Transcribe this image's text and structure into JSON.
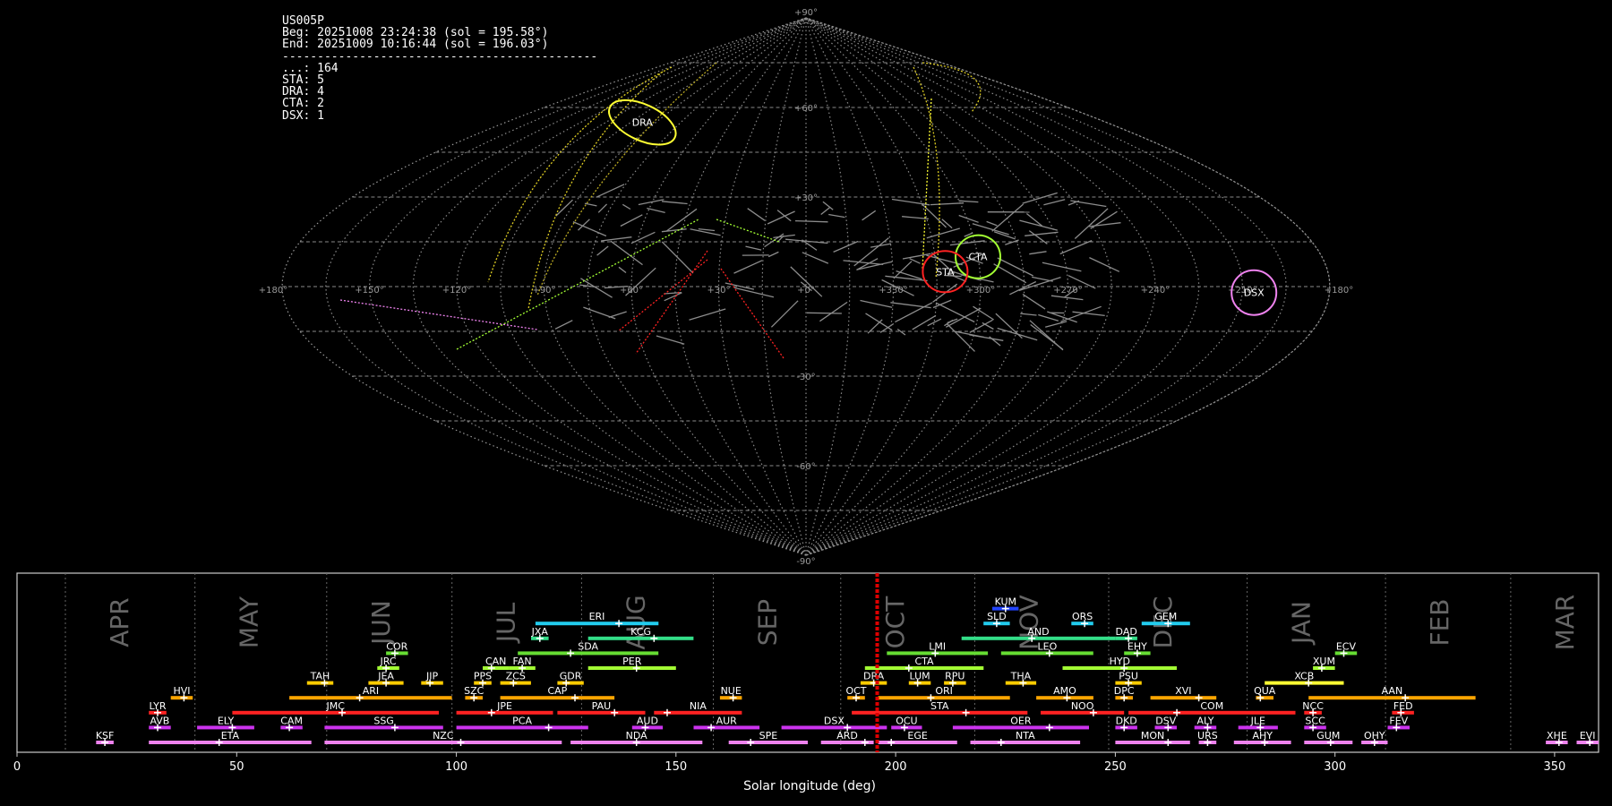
{
  "info": {
    "station": "US005P",
    "begin": "Beg: 20251008 23:24:38 (sol = 195.58°)",
    "end": "End: 20251009 10:16:44 (sol = 196.03°)",
    "separator": "---------------------------------------------",
    "counts": [
      {
        "label": "...",
        "value": 164
      },
      {
        "label": "STA",
        "value": 5
      },
      {
        "label": "DRA",
        "value": 4
      },
      {
        "label": "CTA",
        "value": 2
      },
      {
        "label": "DSX",
        "value": 1
      }
    ]
  },
  "chart_data": [
    {
      "type": "scatter",
      "projection": "sinusoidal",
      "x_ticks": [
        "+180°",
        "+150°",
        "+120°",
        "+90°",
        "+60°",
        "+30°",
        "+0°",
        "+330°",
        "+300°",
        "+270°",
        "+240°",
        "+210°",
        "+180°"
      ],
      "y_ticks": [
        "+90°",
        "+60°",
        "+30°",
        "-30°",
        "-60°",
        "-90°"
      ],
      "grid": true,
      "radiants": [
        {
          "name": "DRA",
          "ra": 262,
          "dec": 55,
          "color": "#ffff33"
        },
        {
          "name": "CTA",
          "ra": 60,
          "dec": 10,
          "color": "#a3ff33"
        },
        {
          "name": "STA",
          "ra": 48,
          "dec": 5,
          "color": "#ff2222"
        },
        {
          "name": "DSX",
          "ra": 154,
          "dec": -2,
          "color": "#ee82ee"
        }
      ]
    },
    {
      "type": "bar",
      "orientation": "horizontal",
      "xlabel": "Solar longitude (deg)",
      "xlim": [
        0,
        360
      ],
      "x_ticks": [
        0,
        50,
        100,
        150,
        200,
        250,
        300,
        350
      ],
      "current_sol": 195.8,
      "months": [
        {
          "name": "APR",
          "start": 11
        },
        {
          "name": "MAY",
          "start": 40.5
        },
        {
          "name": "JUN",
          "start": 70.5
        },
        {
          "name": "JUL",
          "start": 99
        },
        {
          "name": "AUG",
          "start": 128.5
        },
        {
          "name": "SEP",
          "start": 158.5
        },
        {
          "name": "OCT",
          "start": 187.5
        },
        {
          "name": "NOV",
          "start": 218
        },
        {
          "name": "DEC",
          "start": 248.5
        },
        {
          "name": "JAN",
          "start": 280
        },
        {
          "name": "FEB",
          "start": 311.5
        },
        {
          "name": "MAR",
          "start": 340
        }
      ],
      "showers": [
        {
          "code": "KSF",
          "start": 18,
          "end": 22,
          "peak": 20,
          "row": 0,
          "color": "#ee82ee"
        },
        {
          "code": "ETA",
          "start": 30,
          "end": 67,
          "peak": 46,
          "row": 0,
          "color": "#ee82ee"
        },
        {
          "code": "NZC",
          "start": 70,
          "end": 124,
          "peak": 101,
          "row": 0,
          "color": "#ee82ee"
        },
        {
          "code": "NDA",
          "start": 126,
          "end": 156,
          "peak": 141,
          "row": 0,
          "color": "#ee82ee"
        },
        {
          "code": "SPE",
          "start": 162,
          "end": 180,
          "peak": 167,
          "row": 0,
          "color": "#ee82ee"
        },
        {
          "code": "ARD",
          "start": 183,
          "end": 195,
          "peak": 193,
          "row": 0,
          "color": "#ee82ee"
        },
        {
          "code": "EGE",
          "start": 196,
          "end": 214,
          "peak": 199,
          "row": 0,
          "color": "#ee82ee"
        },
        {
          "code": "NTA",
          "start": 217,
          "end": 242,
          "peak": 224,
          "row": 0,
          "color": "#ee82ee"
        },
        {
          "code": "MON",
          "start": 250,
          "end": 267,
          "peak": 262,
          "row": 0,
          "color": "#ee82ee"
        },
        {
          "code": "URS",
          "start": 269,
          "end": 273,
          "peak": 271,
          "row": 0,
          "color": "#ee82ee"
        },
        {
          "code": "AHY",
          "start": 277,
          "end": 290,
          "peak": 284,
          "row": 0,
          "color": "#ee82ee"
        },
        {
          "code": "GUM",
          "start": 293,
          "end": 304,
          "peak": 299,
          "row": 0,
          "color": "#ee82ee"
        },
        {
          "code": "OHY",
          "start": 306,
          "end": 312,
          "peak": 309,
          "row": 0,
          "color": "#ee82ee"
        },
        {
          "code": "XHE",
          "start": 348,
          "end": 353,
          "peak": 351,
          "row": 0,
          "color": "#ee82ee"
        },
        {
          "code": "EVI",
          "start": 355,
          "end": 360,
          "peak": 358,
          "row": 0,
          "color": "#ee82ee"
        },
        {
          "code": "AVB",
          "start": 30,
          "end": 35,
          "peak": 32,
          "row": 1,
          "color": "#cc33ee"
        },
        {
          "code": "ELY",
          "start": 41,
          "end": 54,
          "peak": 49,
          "row": 1,
          "color": "#cc33ee"
        },
        {
          "code": "CAM",
          "start": 60,
          "end": 65,
          "peak": 62,
          "row": 1,
          "color": "#cc33ee"
        },
        {
          "code": "SSG",
          "start": 70,
          "end": 97,
          "peak": 86,
          "row": 1,
          "color": "#cc33ee"
        },
        {
          "code": "PCA",
          "start": 100,
          "end": 130,
          "peak": 121,
          "row": 1,
          "color": "#cc33ee"
        },
        {
          "code": "AUD",
          "start": 140,
          "end": 147,
          "peak": 143,
          "row": 1,
          "color": "#cc33ee"
        },
        {
          "code": "AUR",
          "start": 154,
          "end": 169,
          "peak": 158,
          "row": 1,
          "color": "#cc33ee"
        },
        {
          "code": "DSX",
          "start": 174,
          "end": 198,
          "peak": 189,
          "row": 1,
          "color": "#cc33ee"
        },
        {
          "code": "OCU",
          "start": 199,
          "end": 206,
          "peak": 202,
          "row": 1,
          "color": "#cc33ee"
        },
        {
          "code": "OER",
          "start": 213,
          "end": 244,
          "peak": 235,
          "row": 1,
          "color": "#cc33ee"
        },
        {
          "code": "DKD",
          "start": 250,
          "end": 255,
          "peak": 252,
          "row": 1,
          "color": "#cc33ee"
        },
        {
          "code": "DSV",
          "start": 259,
          "end": 264,
          "peak": 262,
          "row": 1,
          "color": "#cc33ee"
        },
        {
          "code": "ALY",
          "start": 268,
          "end": 273,
          "peak": 271,
          "row": 1,
          "color": "#cc33ee"
        },
        {
          "code": "JLE",
          "start": 278,
          "end": 287,
          "peak": 283,
          "row": 1,
          "color": "#cc33ee"
        },
        {
          "code": "SCC",
          "start": 293,
          "end": 298,
          "peak": 295,
          "row": 1,
          "color": "#cc33ee"
        },
        {
          "code": "FEV",
          "start": 312,
          "end": 317,
          "peak": 314,
          "row": 1,
          "color": "#cc33ee"
        },
        {
          "code": "LYR",
          "start": 30,
          "end": 34,
          "peak": 32,
          "row": 2,
          "color": "#ff2222"
        },
        {
          "code": "JMC",
          "start": 49,
          "end": 96,
          "peak": 74,
          "row": 2,
          "color": "#ff2222"
        },
        {
          "code": "JPE",
          "start": 100,
          "end": 122,
          "peak": 108,
          "row": 2,
          "color": "#ff2222"
        },
        {
          "code": "PAU",
          "start": 123,
          "end": 143,
          "peak": 136,
          "row": 2,
          "color": "#ff2222"
        },
        {
          "code": "NIA",
          "start": 145,
          "end": 165,
          "peak": 148,
          "row": 2,
          "color": "#ff2222"
        },
        {
          "code": "STA",
          "start": 190,
          "end": 230,
          "peak": 216,
          "row": 2,
          "color": "#ff2222"
        },
        {
          "code": "NOO",
          "start": 233,
          "end": 252,
          "peak": 245,
          "row": 2,
          "color": "#ff2222"
        },
        {
          "code": "COM",
          "start": 253,
          "end": 291,
          "peak": 264,
          "row": 2,
          "color": "#ff2222"
        },
        {
          "code": "NCC",
          "start": 293,
          "end": 297,
          "peak": 295,
          "row": 2,
          "color": "#ff2222"
        },
        {
          "code": "FED",
          "start": 313,
          "end": 318,
          "peak": 315,
          "row": 2,
          "color": "#ff2222"
        },
        {
          "code": "HVI",
          "start": 35,
          "end": 40,
          "peak": 38,
          "row": 3,
          "color": "#ffa500"
        },
        {
          "code": "ARI",
          "start": 62,
          "end": 99,
          "peak": 78,
          "row": 3,
          "color": "#ffa500"
        },
        {
          "code": "SZC",
          "start": 102,
          "end": 106,
          "peak": 104,
          "row": 3,
          "color": "#ffa500"
        },
        {
          "code": "CAP",
          "start": 110,
          "end": 136,
          "peak": 127,
          "row": 3,
          "color": "#ffa500"
        },
        {
          "code": "NUE",
          "start": 160,
          "end": 165,
          "peak": 163,
          "row": 3,
          "color": "#ffa500"
        },
        {
          "code": "OCT",
          "start": 189,
          "end": 193,
          "peak": 191,
          "row": 3,
          "color": "#ffa500"
        },
        {
          "code": "ORI",
          "start": 196,
          "end": 226,
          "peak": 208,
          "row": 3,
          "color": "#ffa500"
        },
        {
          "code": "AMO",
          "start": 232,
          "end": 245,
          "peak": 239,
          "row": 3,
          "color": "#ffa500"
        },
        {
          "code": "DPC",
          "start": 250,
          "end": 254,
          "peak": 252,
          "row": 3,
          "color": "#ffa500"
        },
        {
          "code": "XVI",
          "start": 258,
          "end": 273,
          "peak": 269,
          "row": 3,
          "color": "#ffa500"
        },
        {
          "code": "QUA",
          "start": 282,
          "end": 286,
          "peak": 283,
          "row": 3,
          "color": "#ffa500"
        },
        {
          "code": "AAN",
          "start": 294,
          "end": 332,
          "peak": 316,
          "row": 3,
          "color": "#ffa500"
        },
        {
          "code": "TAH",
          "start": 66,
          "end": 72,
          "peak": 70,
          "row": 4,
          "color": "#ffcc00"
        },
        {
          "code": "JEA",
          "start": 80,
          "end": 88,
          "peak": 84,
          "row": 4,
          "color": "#ffcc00"
        },
        {
          "code": "JIP",
          "start": 92,
          "end": 97,
          "peak": 94,
          "row": 4,
          "color": "#ffcc00"
        },
        {
          "code": "PPS",
          "start": 104,
          "end": 108,
          "peak": 106,
          "row": 4,
          "color": "#ffcc00"
        },
        {
          "code": "ZCS",
          "start": 110,
          "end": 117,
          "peak": 113,
          "row": 4,
          "color": "#ffcc00"
        },
        {
          "code": "GDR",
          "start": 123,
          "end": 129,
          "peak": 125,
          "row": 4,
          "color": "#ffcc00"
        },
        {
          "code": "DRA",
          "start": 192,
          "end": 198,
          "peak": 195,
          "row": 4,
          "color": "#ffcc00"
        },
        {
          "code": "LUM",
          "start": 203,
          "end": 208,
          "peak": 205,
          "row": 4,
          "color": "#ffcc00"
        },
        {
          "code": "RPU",
          "start": 211,
          "end": 216,
          "peak": 213,
          "row": 4,
          "color": "#ffcc00"
        },
        {
          "code": "THA",
          "start": 225,
          "end": 232,
          "peak": 229,
          "row": 4,
          "color": "#ffcc00"
        },
        {
          "code": "PSU",
          "start": 250,
          "end": 256,
          "peak": 253,
          "row": 4,
          "color": "#ffcc00"
        },
        {
          "code": "XCB",
          "start": 284,
          "end": 302,
          "peak": 294,
          "row": 4,
          "color": "#ffff33"
        },
        {
          "code": "JRC",
          "start": 82,
          "end": 87,
          "peak": 84,
          "row": 5,
          "color": "#a3ff33"
        },
        {
          "code": "CAN",
          "start": 106,
          "end": 112,
          "peak": 108,
          "row": 5,
          "color": "#a3ff33"
        },
        {
          "code": "FAN",
          "start": 112,
          "end": 118,
          "peak": 115,
          "row": 5,
          "color": "#a3ff33"
        },
        {
          "code": "PER",
          "start": 130,
          "end": 150,
          "peak": 141,
          "row": 5,
          "color": "#a3ff33"
        },
        {
          "code": "CTA",
          "start": 193,
          "end": 220,
          "peak": 203,
          "row": 5,
          "color": "#a3ff33"
        },
        {
          "code": "HYD",
          "start": 238,
          "end": 264,
          "peak": 252,
          "row": 5,
          "color": "#a3ff33"
        },
        {
          "code": "XUM",
          "start": 295,
          "end": 300,
          "peak": 297,
          "row": 5,
          "color": "#a3ff33"
        },
        {
          "code": "COR",
          "start": 84,
          "end": 89,
          "peak": 86,
          "row": 6,
          "color": "#66dd33"
        },
        {
          "code": "SDA",
          "start": 114,
          "end": 146,
          "peak": 126,
          "row": 6,
          "color": "#66dd33"
        },
        {
          "code": "LMI",
          "start": 198,
          "end": 221,
          "peak": 209,
          "row": 6,
          "color": "#66dd33"
        },
        {
          "code": "LEO",
          "start": 224,
          "end": 245,
          "peak": 235,
          "row": 6,
          "color": "#66dd33"
        },
        {
          "code": "EHY",
          "start": 252,
          "end": 258,
          "peak": 255,
          "row": 6,
          "color": "#66dd33"
        },
        {
          "code": "ECV",
          "start": 300,
          "end": 305,
          "peak": 302,
          "row": 6,
          "color": "#66dd33"
        },
        {
          "code": "JXA",
          "start": 117,
          "end": 121,
          "peak": 119,
          "row": 7,
          "color": "#33dd88"
        },
        {
          "code": "KCG",
          "start": 130,
          "end": 154,
          "peak": 145,
          "row": 7,
          "color": "#33dd88"
        },
        {
          "code": "AND",
          "start": 215,
          "end": 250,
          "peak": 231,
          "row": 7,
          "color": "#33dd88"
        },
        {
          "code": "DAD",
          "start": 250,
          "end": 255,
          "peak": 253,
          "row": 7,
          "color": "#33dd88"
        },
        {
          "code": "ERI",
          "start": 118,
          "end": 146,
          "peak": 137,
          "row": 8,
          "color": "#22ccee"
        },
        {
          "code": "SLD",
          "start": 220,
          "end": 226,
          "peak": 223,
          "row": 8,
          "color": "#22ccee"
        },
        {
          "code": "ORS",
          "start": 240,
          "end": 245,
          "peak": 243,
          "row": 8,
          "color": "#22ccee"
        },
        {
          "code": "GEM",
          "start": 256,
          "end": 267,
          "peak": 262,
          "row": 8,
          "color": "#22ccee"
        },
        {
          "code": "KUM",
          "start": 222,
          "end": 228,
          "peak": 225,
          "row": 9,
          "color": "#2244ff"
        }
      ]
    }
  ]
}
